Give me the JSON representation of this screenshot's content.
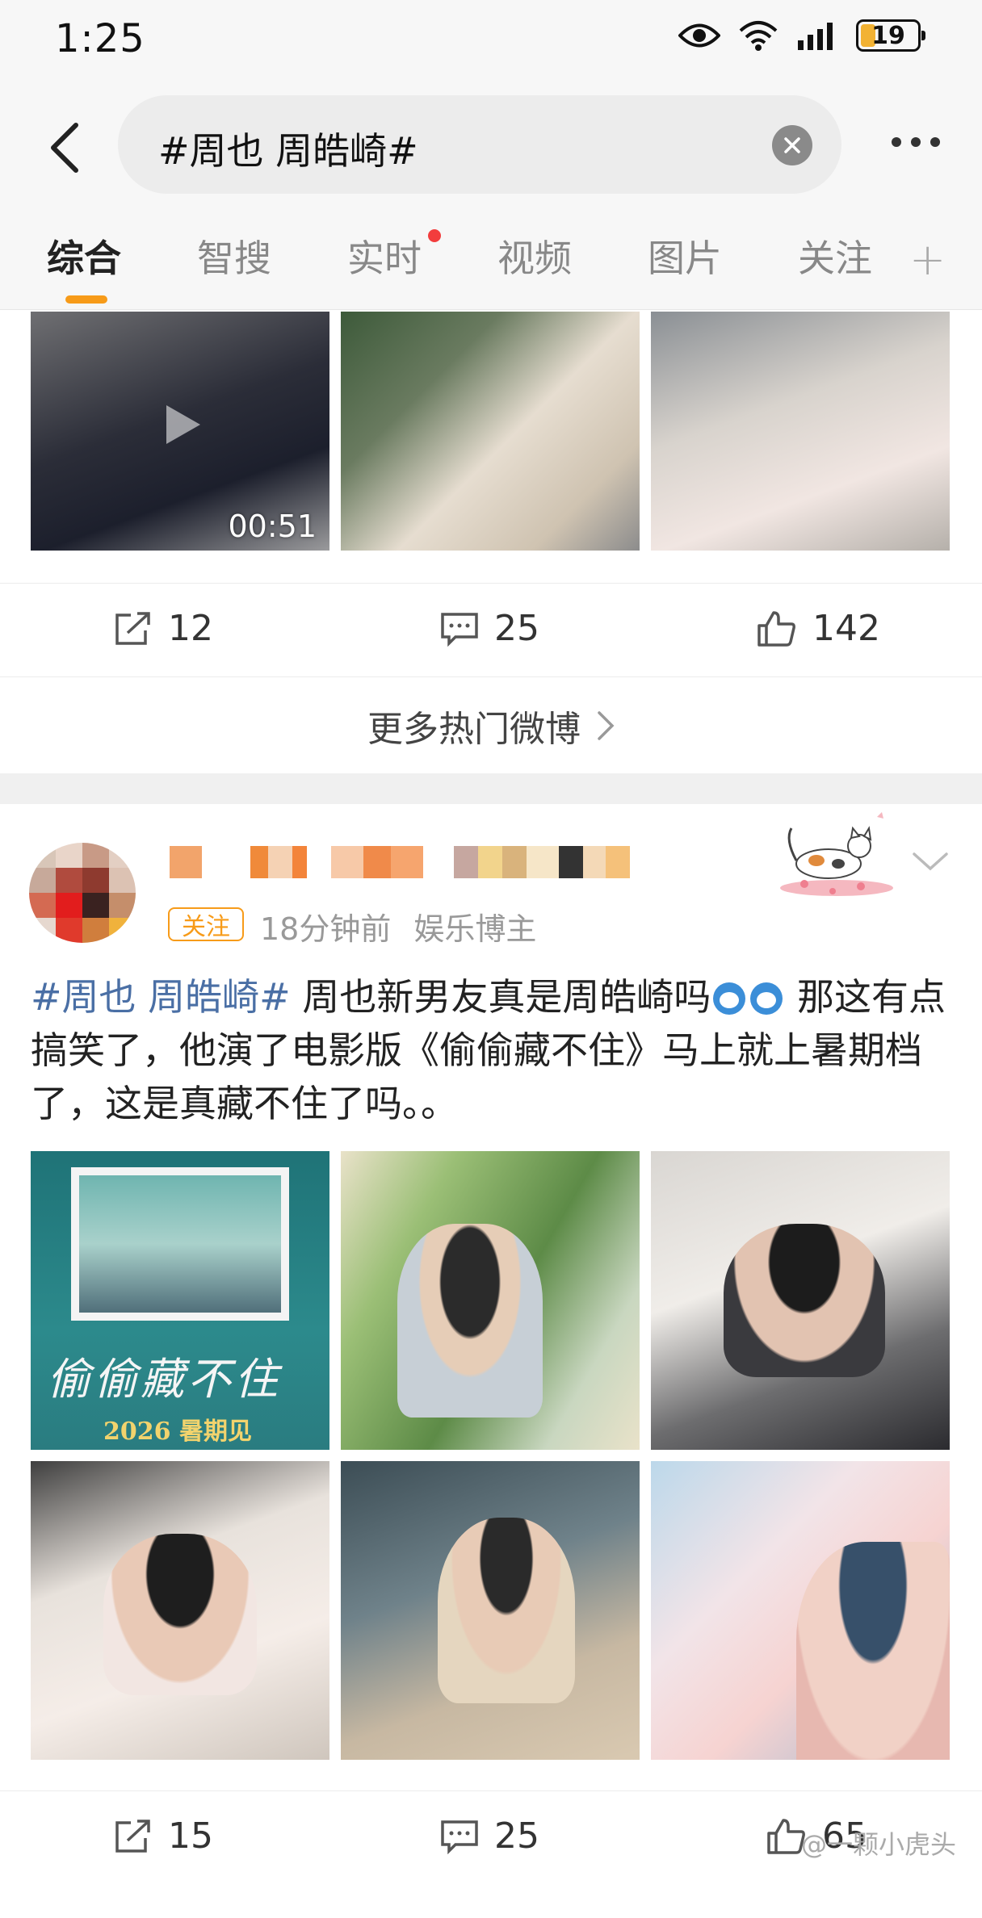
{
  "status_bar": {
    "time": "1:25",
    "battery": "19"
  },
  "search": {
    "query": "#周也 周皓崎#"
  },
  "tabs": [
    {
      "label": "综合",
      "active": true
    },
    {
      "label": "智搜",
      "active": false
    },
    {
      "label": "实时",
      "active": false,
      "has_dot": true
    },
    {
      "label": "视频",
      "active": false
    },
    {
      "label": "图片",
      "active": false
    },
    {
      "label": "关注",
      "active": false
    }
  ],
  "top_post": {
    "video_duration": "00:51",
    "repost_count": "12",
    "comment_count": "25",
    "like_count": "142"
  },
  "more_hot": {
    "label": "更多热门微博"
  },
  "post": {
    "follow_label": "关注",
    "time": "18分钟前",
    "role": "娱乐博主",
    "topic": "#周也 周皓崎#",
    "text_part1": " 周也新男友真是周皓崎吗",
    "text_part2": " 那这有点搞笑了，他演了电影版《偷偷藏不住》马上就上暑期档了，这是真藏不住了吗。。",
    "repost_count": "15",
    "comment_count": "25",
    "like_count": "65"
  },
  "images": {
    "poster1_title": "偷偷藏不住",
    "poster1_date": "2026 暑期见"
  },
  "watermark": "@一颗小虎头",
  "colors": {
    "accent": "#f79b19",
    "topic": "#4a6fa5",
    "dot": "#f23d3d"
  }
}
